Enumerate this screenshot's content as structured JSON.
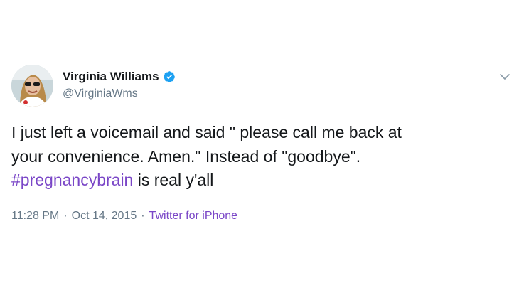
{
  "author": {
    "display_name": "Virginia Williams",
    "handle": "@VirginiaWms",
    "verified": true
  },
  "icons": {
    "avatar": "profile-photo",
    "verified": "verified-badge-icon",
    "menu": "chevron-down-icon"
  },
  "tweet": {
    "text_line_1": "I just left a voicemail and said \" please call me back at",
    "text_line_2": "your convenience. Amen.\" Instead of \"goodbye\".",
    "hashtag": "#pregnancybrain",
    "text_after_hashtag": " is real y'all"
  },
  "meta": {
    "time": "11:28 PM",
    "separator_1": "·",
    "date": "Oct 14, 2015",
    "separator_2": "·",
    "source": "Twitter for iPhone"
  },
  "colors": {
    "link": "#7a46c7",
    "verified_badge": "#1da1f2",
    "secondary_text": "#657786"
  }
}
